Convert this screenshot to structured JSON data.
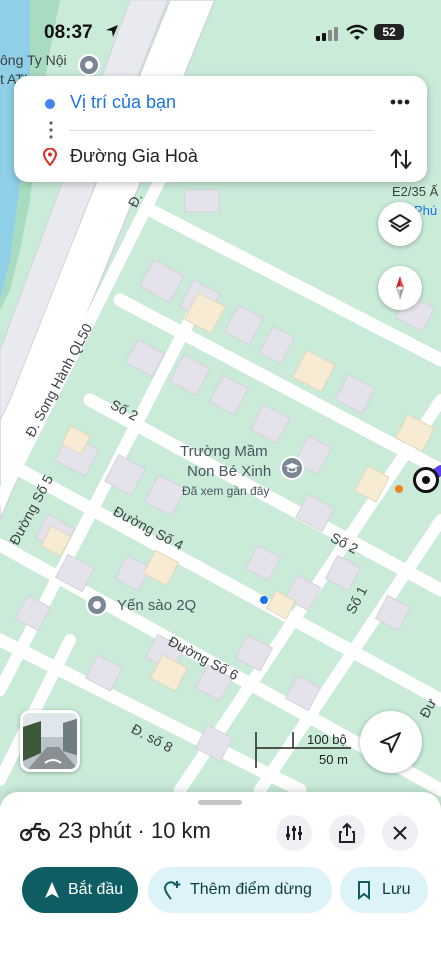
{
  "status_bar": {
    "time": "08:37",
    "battery": "52"
  },
  "route": {
    "origin": "Vị trí của bạn",
    "destination": "Đường Gia Hoà"
  },
  "map": {
    "street_labels": {
      "song_hanh": "Đ. Song Hành QL50",
      "so2_a": "Số 2",
      "so2_b": "Số 2",
      "so5": "Đường Số 5",
      "so4": "Đường Số 4",
      "so1": "Số 1",
      "so6": "Đường Số 6",
      "so8": "Đ. số 8",
      "top_partial": "Đ.",
      "top_right": "E2/35 Ấ",
      "top_right2": "Phú",
      "top_left1": "ông Ty Nội",
      "top_left2": "t ATI",
      "right_edge": "Đư"
    },
    "pois": {
      "school_line1": "Trường Mầm",
      "school_line2": "Non Bé Xinh",
      "school_sub": "Đã xem gần đây",
      "yensao": "Yến sào 2Q"
    },
    "scale": {
      "top": "100 bộ",
      "bottom": "50 m"
    }
  },
  "trip": {
    "mode_icon": "motorcycle-icon",
    "summary": "23 phút · 10 km",
    "start_label": "Bắt đầu",
    "add_stop_label": "Thêm điểm dừng",
    "save_label": "Lưu"
  },
  "colors": {
    "map_bg": "#c9ebd8",
    "road": "#ffffff",
    "block": "#e6e3ea",
    "accent_dark": "#0e5d63",
    "accent_light": "#ddf3f7",
    "blue": "#1a73e8",
    "route_purple": "#5b3df5"
  }
}
